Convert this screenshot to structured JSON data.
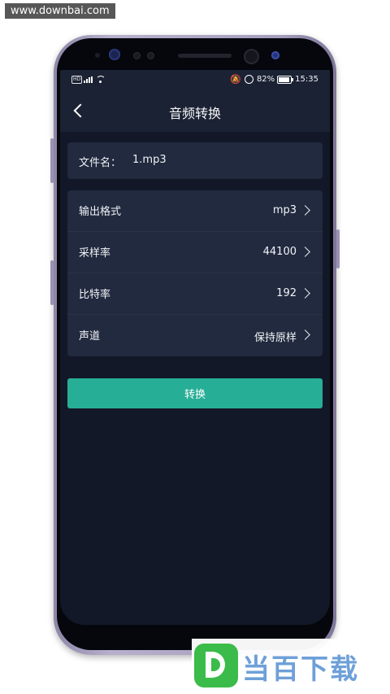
{
  "watermark": {
    "site": "www.downbai.com",
    "brand": "当百下载"
  },
  "status_bar": {
    "battery": "82%",
    "time": "15:35",
    "icons": [
      "hd-icon",
      "signal-icon",
      "wifi-icon",
      "mute-icon",
      "speed-icon",
      "battery-icon"
    ]
  },
  "header": {
    "title": "音频转换"
  },
  "file": {
    "label": "文件名：",
    "value": "1.mp3"
  },
  "settings": [
    {
      "label": "输出格式",
      "value": "mp3"
    },
    {
      "label": "采样率",
      "value": "44100"
    },
    {
      "label": "比特率",
      "value": "192"
    },
    {
      "label": "声道",
      "value": "保持原样"
    }
  ],
  "actions": {
    "convert": "转换"
  },
  "colors": {
    "background": "#121827",
    "card": "#212a3e",
    "accent": "#27ae96",
    "brand_green": "#3bbb49",
    "brand_blue": "#6ea0d8"
  }
}
